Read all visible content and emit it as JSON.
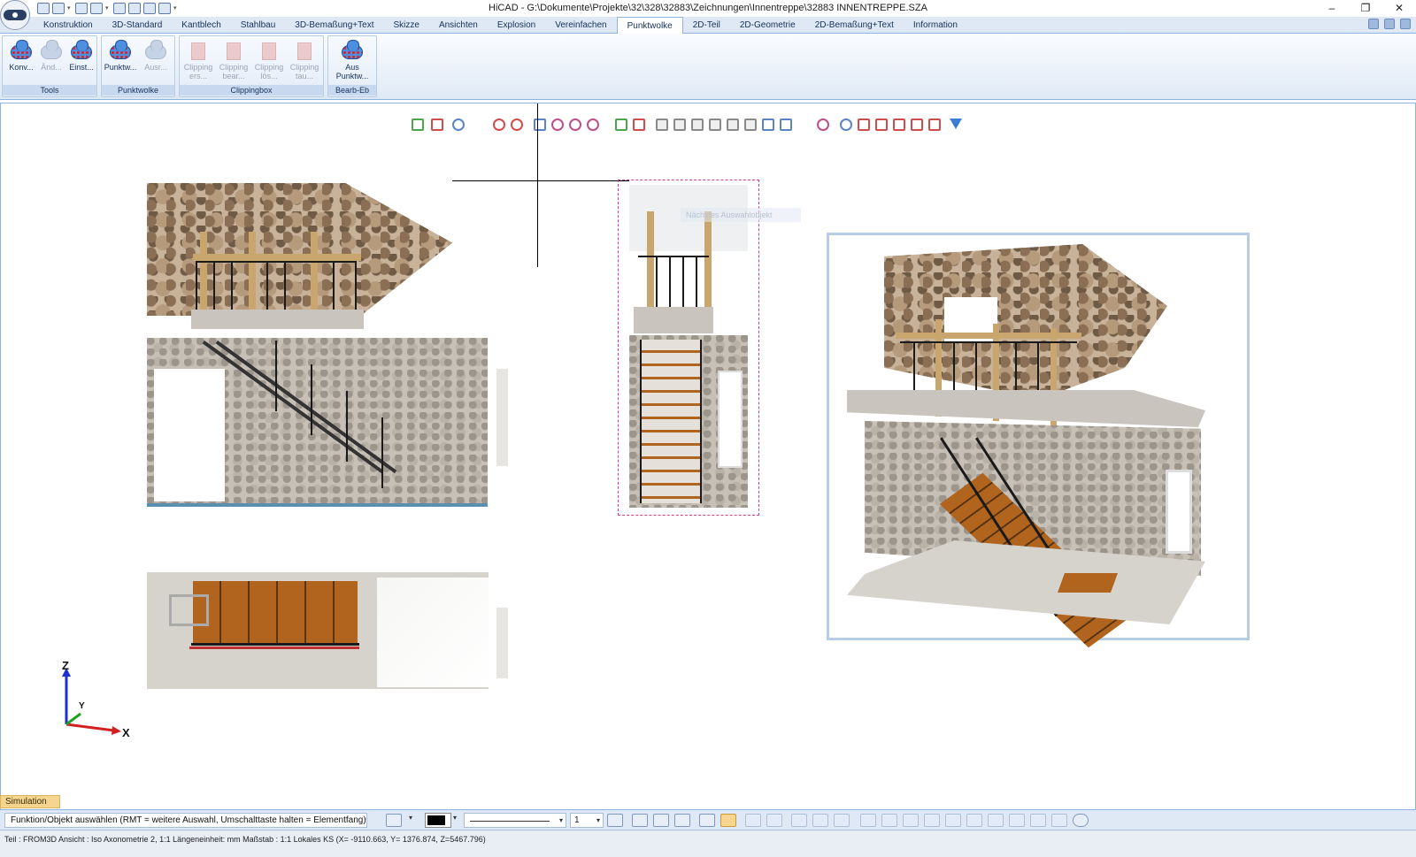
{
  "window": {
    "title": "HiCAD - G:\\Dokumente\\Projekte\\32\\328\\32883\\Zeichnungen\\Innentreppe\\32883 INNENTREPPE.SZA",
    "minimize": "–",
    "restore": "❐",
    "close": "✕"
  },
  "ribbon": {
    "tabs": [
      {
        "label": "Konstruktion"
      },
      {
        "label": "3D-Standard"
      },
      {
        "label": "Kantblech"
      },
      {
        "label": "Stahlbau"
      },
      {
        "label": "3D-Bemaßung+Text"
      },
      {
        "label": "Skizze"
      },
      {
        "label": "Ansichten"
      },
      {
        "label": "Explosion"
      },
      {
        "label": "Vereinfachen"
      },
      {
        "label": "Punktwolke"
      },
      {
        "label": "2D-Teil"
      },
      {
        "label": "2D-Geometrie"
      },
      {
        "label": "2D-Bemaßung+Text"
      },
      {
        "label": "Information"
      }
    ],
    "active_tab": "Punktwolke",
    "groups": {
      "tools": {
        "label": "Tools",
        "buttons": [
          {
            "label": "Konv...",
            "icon": "pointcloud-convert-icon",
            "enabled": true
          },
          {
            "label": "Änd...",
            "icon": "pointcloud-change-icon",
            "enabled": false
          },
          {
            "label": "Einst...",
            "icon": "pointcloud-settings-icon",
            "enabled": true
          }
        ]
      },
      "punktwolke": {
        "label": "Punktwolke",
        "buttons": [
          {
            "label": "Punktw...",
            "icon": "pointcloud-insert-icon",
            "enabled": true
          },
          {
            "label": "Ausr...",
            "icon": "pointcloud-align-icon",
            "enabled": false
          }
        ]
      },
      "clippingbox": {
        "label": "Clippingbox",
        "buttons": [
          {
            "label": "Clipping\ners...",
            "icon": "clipping-create-icon",
            "enabled": false
          },
          {
            "label": "Clipping\nbear...",
            "icon": "clipping-edit-icon",
            "enabled": false
          },
          {
            "label": "Clipping\nlös...",
            "icon": "clipping-delete-icon",
            "enabled": false
          },
          {
            "label": "Clipping\ntau...",
            "icon": "clipping-swap-icon",
            "enabled": false
          }
        ]
      },
      "bearb_eb": {
        "label": "Bearb-Eb",
        "buttons": [
          {
            "label": "Aus\nPunktw...",
            "icon": "pointcloud-plane-icon",
            "enabled": true
          }
        ]
      }
    }
  },
  "viewport": {
    "tooltip_ghost": "Nächstes Auswahlobjekt",
    "axes": {
      "z": "Z",
      "y": "Y",
      "x": "X"
    }
  },
  "bottom": {
    "simulation_tab": "Simulation",
    "prompt": "Funktion/Objekt auswählen (RMT = weitere Auswahl, Umschalttaste halten = Elementfang)",
    "line_width": "1",
    "dropdown_arrow": "▾"
  },
  "status": {
    "text": "Teil : FROM3D   Ansicht : Iso Axonometrie 2, 1:1   Längeneinheit: mm   Maßstab : 1:1   Lokales KS  (X= -9110.663, Y= 1376.874, Z=5467.796)"
  },
  "colors": {
    "ribbon_bg": "#dfe9f5",
    "accent": "#8db2e3",
    "selection_frame": "#d23b9c",
    "stair_wood": "#b0641e"
  }
}
